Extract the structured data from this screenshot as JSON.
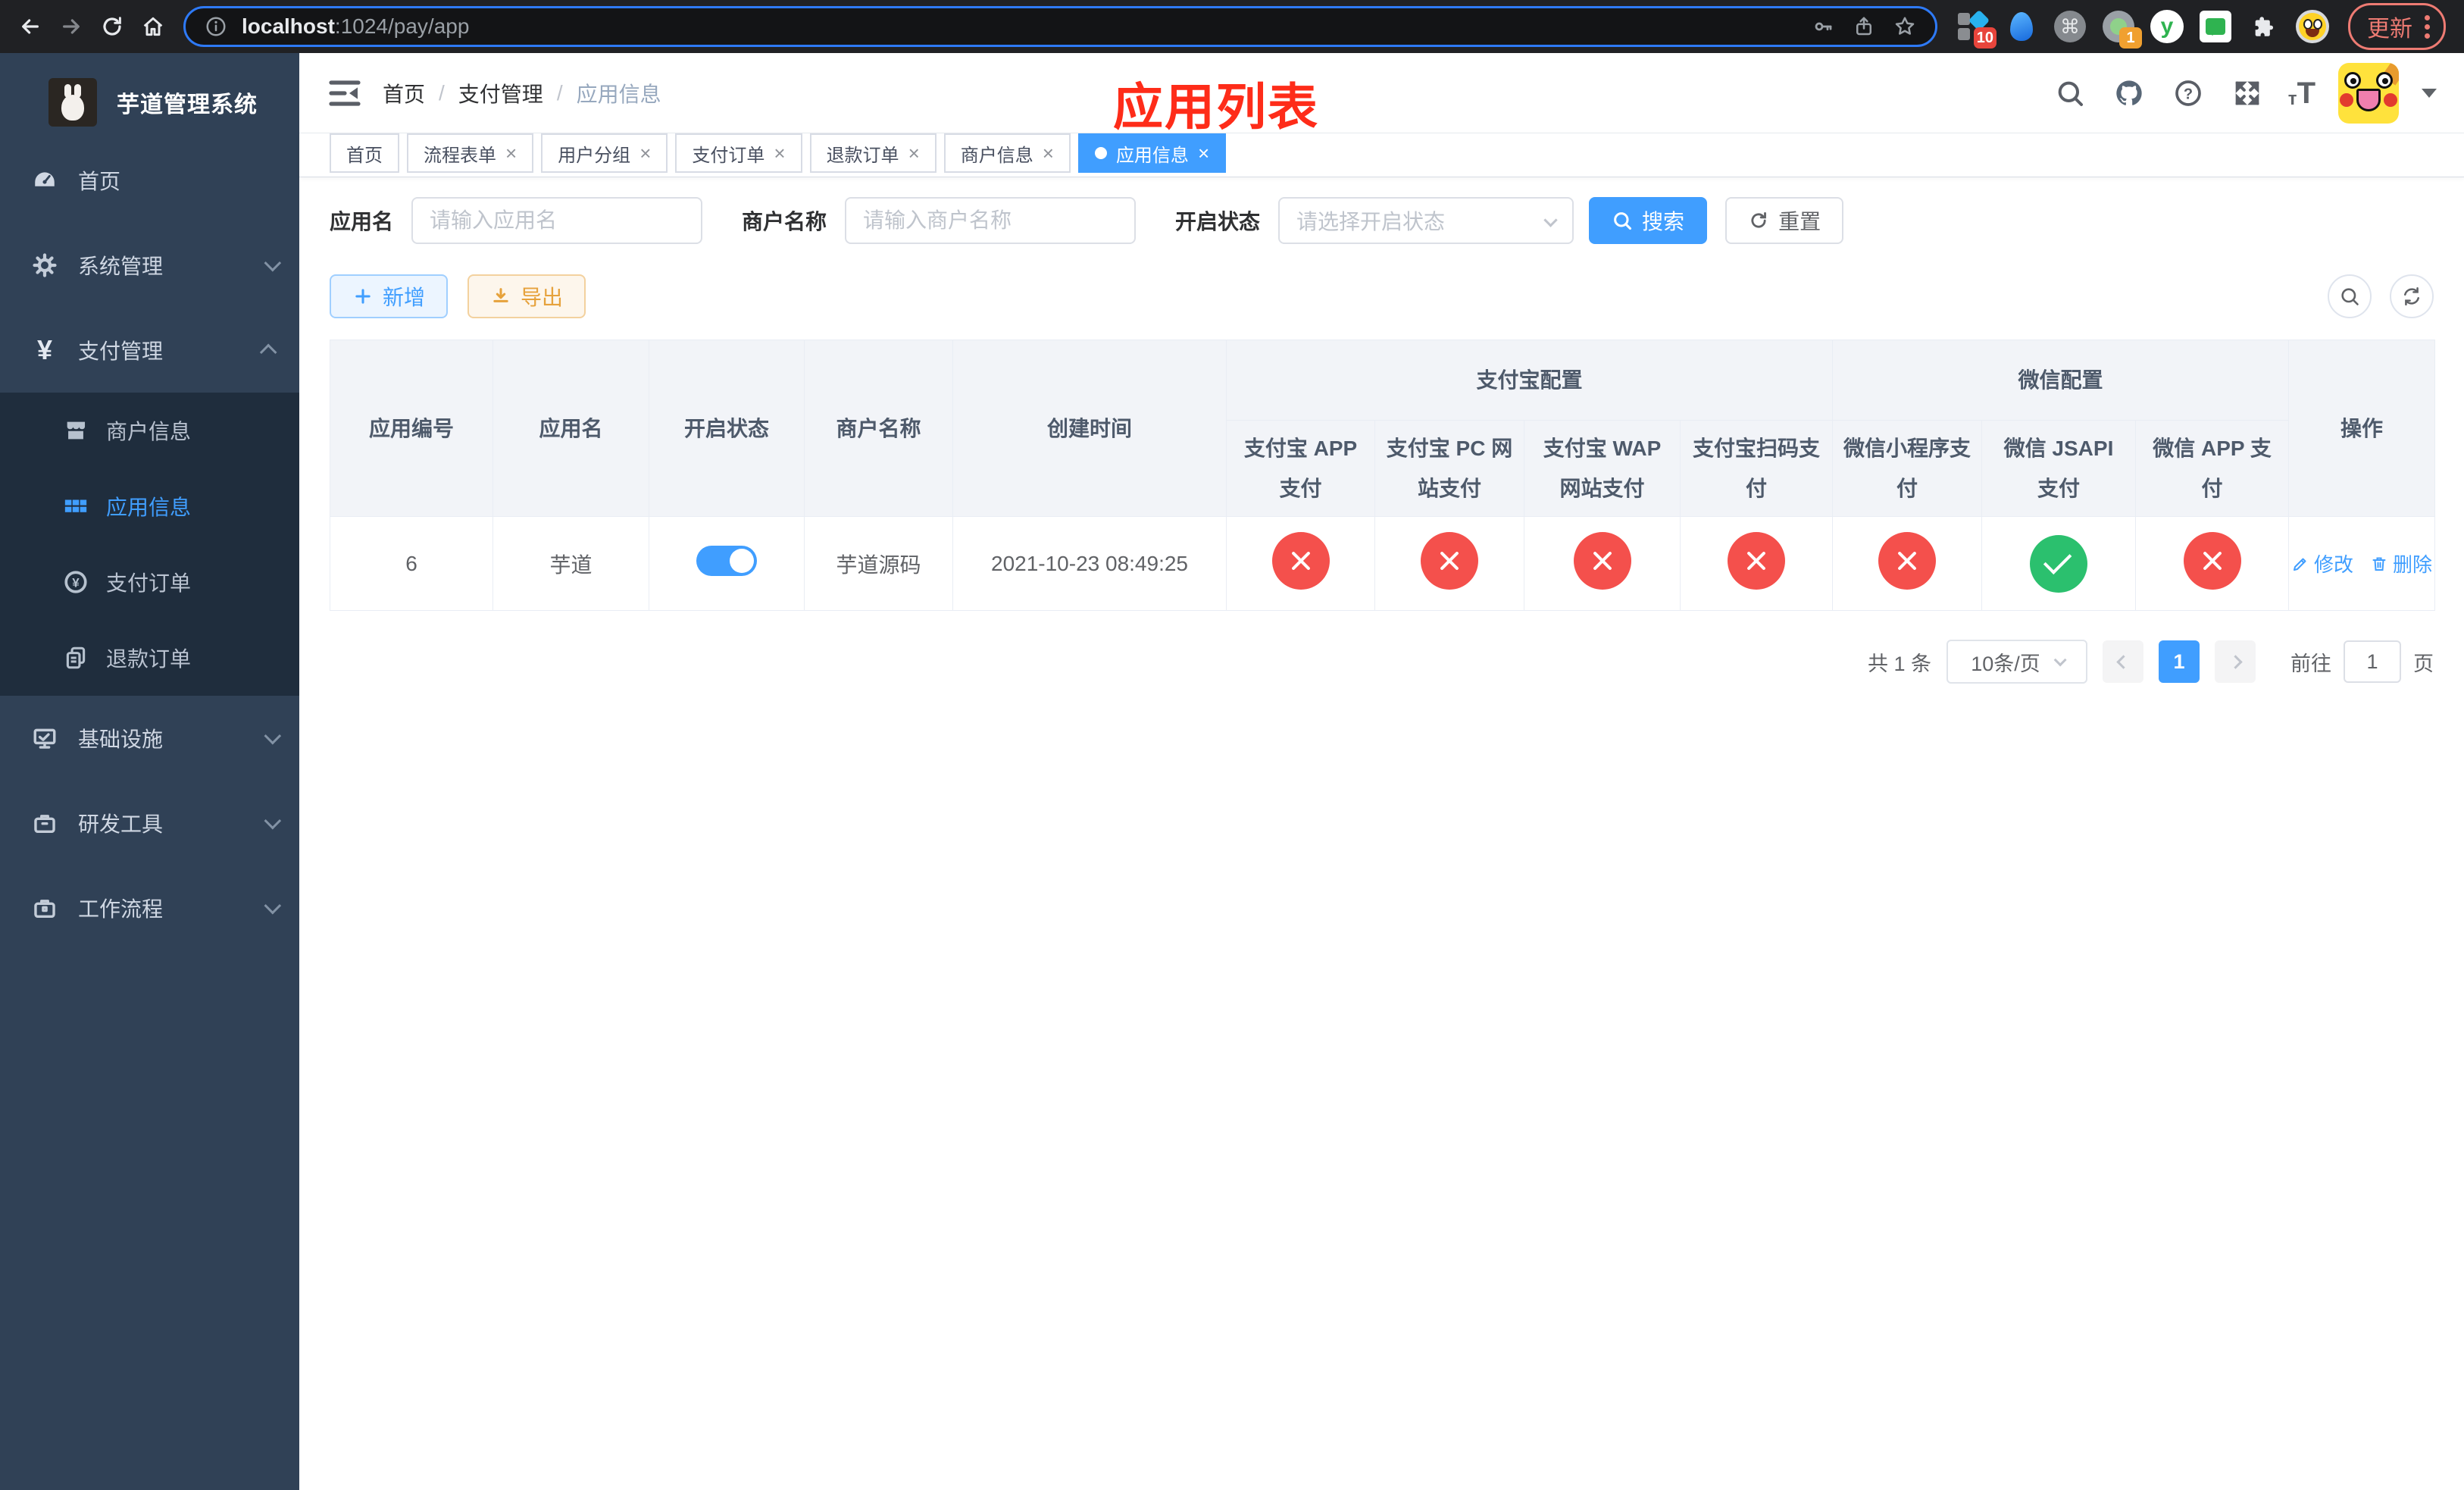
{
  "browser": {
    "url_host": "localhost",
    "url_path": ":1024/pay/app",
    "update_label": "更新",
    "ext_badges": [
      "10",
      "1"
    ],
    "ext_y_letter": "y",
    "ext_cmd_glyph": "⌘"
  },
  "sidebar": {
    "title": "芋道管理系统",
    "menu_top": [
      {
        "label": "首页"
      },
      {
        "label": "系统管理"
      },
      {
        "label": "支付管理"
      }
    ],
    "payment_submenu": [
      {
        "label": "商户信息"
      },
      {
        "label": "应用信息",
        "active": true
      },
      {
        "label": "支付订单"
      },
      {
        "label": "退款订单"
      }
    ],
    "menu_bottom": [
      {
        "label": "基础设施"
      },
      {
        "label": "研发工具"
      },
      {
        "label": "工作流程"
      }
    ]
  },
  "header": {
    "breadcrumb": [
      "首页",
      "支付管理",
      "应用信息"
    ],
    "breadcrumb_separator": "/",
    "overlay_title": "应用列表"
  },
  "tabs": [
    {
      "label": "首页",
      "closable": false,
      "active": false
    },
    {
      "label": "流程表单",
      "closable": true,
      "active": false
    },
    {
      "label": "用户分组",
      "closable": true,
      "active": false
    },
    {
      "label": "支付订单",
      "closable": true,
      "active": false
    },
    {
      "label": "退款订单",
      "closable": true,
      "active": false
    },
    {
      "label": "商户信息",
      "closable": true,
      "active": false
    },
    {
      "label": "应用信息",
      "closable": true,
      "active": true
    }
  ],
  "tab_close_glyph": "×",
  "filters": {
    "app_name_label": "应用名",
    "app_name_placeholder": "请输入应用名",
    "merchant_label": "商户名称",
    "merchant_placeholder": "请输入商户名称",
    "status_label": "开启状态",
    "status_placeholder": "请选择开启状态",
    "search_label": "搜索",
    "reset_label": "重置"
  },
  "toolbar": {
    "add_label": "新增",
    "export_label": "导出"
  },
  "table": {
    "columns_simple": [
      "应用编号",
      "应用名",
      "开启状态",
      "商户名称",
      "创建时间"
    ],
    "group_alipay": "支付宝配置",
    "group_wechat": "微信配置",
    "col_action": "操作",
    "columns_alipay": [
      "支付宝 APP 支付",
      "支付宝 PC 网站支付",
      "支付宝 WAP 网站支付",
      "支付宝扫码支付"
    ],
    "columns_wechat": [
      "微信小程序支付",
      "微信 JSAPI 支付",
      "微信 APP 支付"
    ],
    "row": {
      "id": "6",
      "name": "芋道",
      "enabled": true,
      "merchant": "芋道源码",
      "created_at": "2021-10-23 08:49:25",
      "statuses": [
        "disabled",
        "disabled",
        "disabled",
        "disabled",
        "disabled",
        "enabled",
        "disabled"
      ],
      "actions": [
        "修改",
        "删除"
      ]
    }
  },
  "pagination": {
    "total": "共 1 条",
    "page_size": "10条/页",
    "current_page": "1",
    "goto_label": "前往",
    "goto_value": "1",
    "page_unit": "页"
  },
  "colors": {
    "accent": "#409eff",
    "danger": "#f4504c",
    "success": "#2bc06e",
    "annotation_red": "#fe2c19",
    "sidebar_bg": "#304156",
    "submenu_bg": "#1f2d3d"
  }
}
